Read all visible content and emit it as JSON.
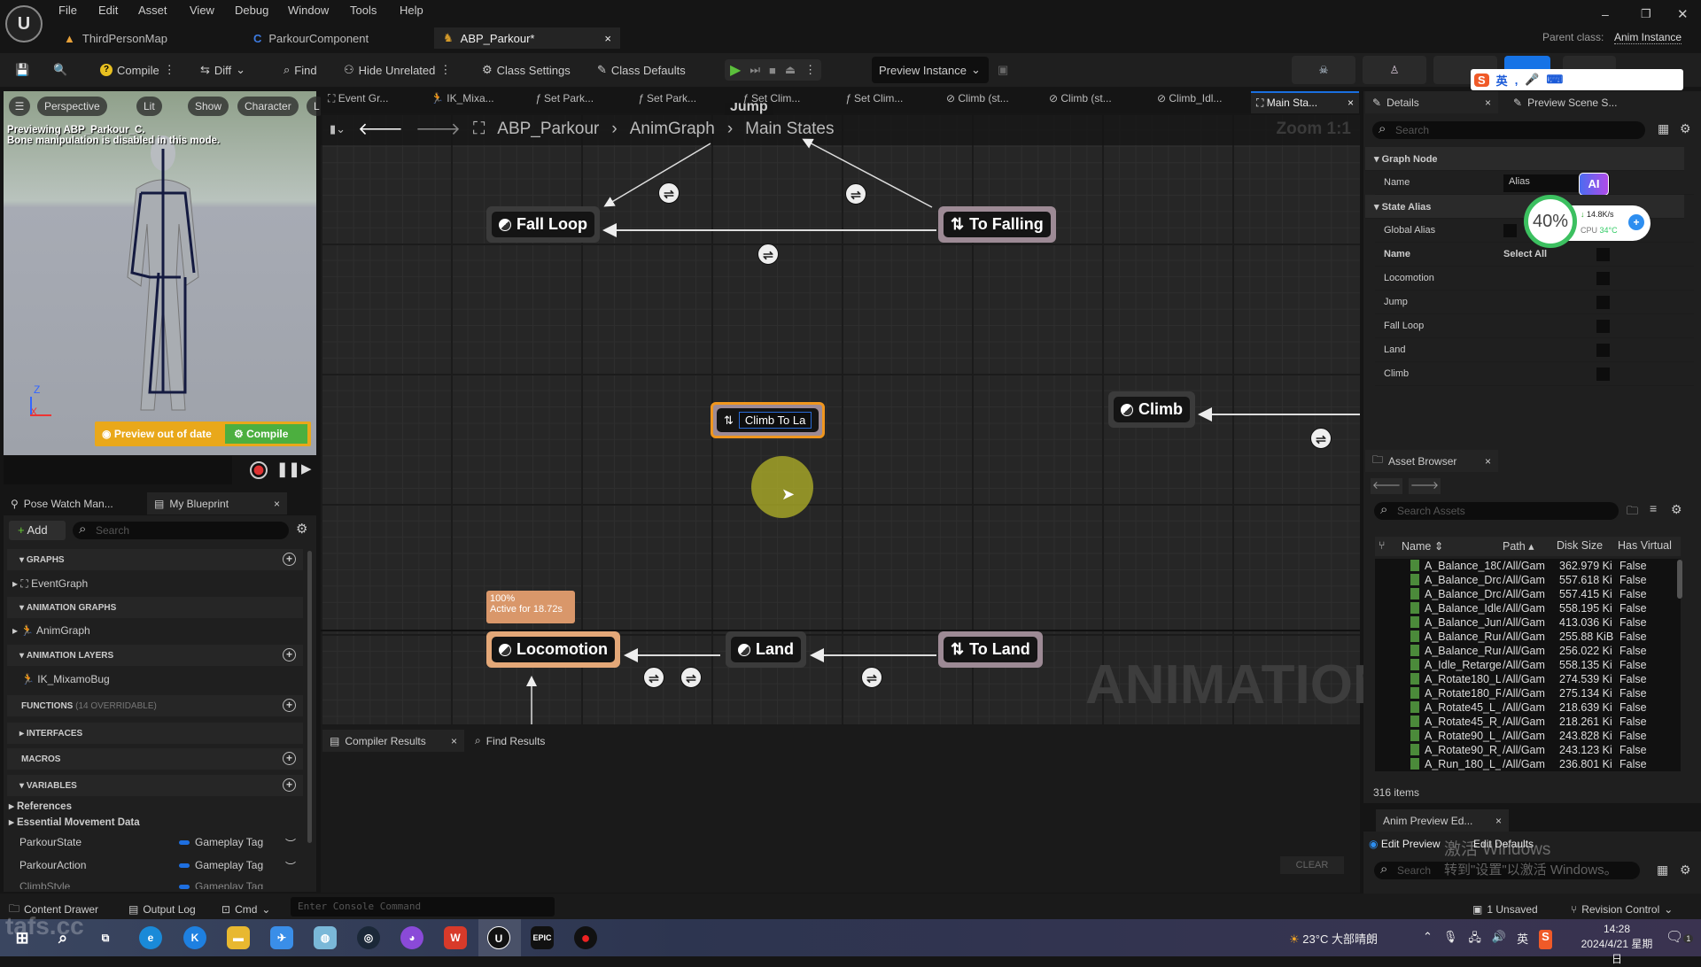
{
  "menu": [
    "File",
    "Edit",
    "Asset",
    "View",
    "Debug",
    "Window",
    "Tools",
    "Help"
  ],
  "doc_tabs": [
    {
      "label": "ThirdPersonMap"
    },
    {
      "label": "ParkourComponent"
    },
    {
      "label": "ABP_Parkour*",
      "active": true
    }
  ],
  "parent_class": {
    "label": "Parent class:",
    "value": "Anim Instance"
  },
  "toolbar": {
    "compile": "Compile",
    "diff": "Diff",
    "find": "Find",
    "hide_unrelated": "Hide Unrelated",
    "class_settings": "Class Settings",
    "class_defaults": "Class Defaults",
    "preview_instance": "Preview Instance"
  },
  "viewport": {
    "chips": [
      "Perspective",
      "Lit",
      "Show",
      "Character",
      "L"
    ],
    "info_line1": "Previewing ABP_Parkour_C.",
    "info_line2": "Bone manipulation is disabled in this mode.",
    "preview_out_of_date": "Preview out of date",
    "compile": "Compile",
    "axis_z": "Z",
    "axis_x": "X"
  },
  "left_tabs": {
    "pose_watch": "Pose Watch Man...",
    "my_blueprint": "My Blueprint"
  },
  "my_blueprint": {
    "add": "Add",
    "search_placeholder": "Search",
    "sections": {
      "graphs": "GRAPHS",
      "anim_graphs": "ANIMATION GRAPHS",
      "anim_layers": "ANIMATION LAYERS",
      "functions": "FUNCTIONS",
      "functions_note": "(14 OVERRIDABLE)",
      "interfaces": "INTERFACES",
      "macros": "MACROS",
      "variables": "VARIABLES"
    },
    "event_graph": "EventGraph",
    "anim_graph": "AnimGraph",
    "layer": "IK_MixamoBug",
    "references": "References",
    "essential": "Essential Movement Data",
    "variables": [
      {
        "name": "ParkourState",
        "type": "Gameplay Tag"
      },
      {
        "name": "ParkourAction",
        "type": "Gameplay Tag"
      },
      {
        "name": "ClimbStyle",
        "type": "Gameplay Tag"
      }
    ]
  },
  "graph_tabs": [
    "Event Gr...",
    "IK_Mixa...",
    "Set Park...",
    "Set Park...",
    "Set Clim...",
    "Set Clim...",
    "Climb (st...",
    "Climb (st...",
    "Climb_Idl...",
    "Main Sta..."
  ],
  "breadcrumb": [
    "ABP_Parkour",
    "AnimGraph",
    "Main States"
  ],
  "zoom": "Zoom 1:1",
  "nodes": {
    "jump": "Jump",
    "fall_loop": "Fall Loop",
    "to_falling": "To Falling",
    "climb_to_la": "Climb To La",
    "climb": "Climb",
    "locomotion": "Locomotion",
    "land": "Land",
    "to_land": "To Land"
  },
  "tooltip": {
    "weight": "100%",
    "active": "Active for 18.72s"
  },
  "watermark": "ANIMATION",
  "bottom_tabs": {
    "compiler_results": "Compiler Results",
    "find_results": "Find Results",
    "clear": "CLEAR"
  },
  "details": {
    "tab": "Details",
    "preview_tab": "Preview Scene S...",
    "search_placeholder": "Search",
    "graph_node": "Graph Node",
    "name_label": "Name",
    "name_value": "Alias",
    "state_alias": "State Alias",
    "global_alias": "Global Alias",
    "name_header": "Name",
    "select_all": "Select All",
    "states": [
      "Locomotion",
      "Jump",
      "Fall Loop",
      "Land",
      "Climb"
    ]
  },
  "overlay_widget": {
    "percent": "40%",
    "net": "14.8K/s",
    "cpu_label": "CPU",
    "cpu_temp": "34°C",
    "ai": "AI"
  },
  "asset_browser": {
    "tab": "Asset Browser",
    "search_placeholder": "Search Assets",
    "columns": [
      "Name",
      "Path",
      "Disk Size",
      "Has Virtual"
    ],
    "rows": [
      [
        "A_Balance_180_",
        "/All/Gam",
        "362.979 Ki",
        "False"
      ],
      [
        "A_Balance_Dro",
        "/All/Gam",
        "557.618 Ki",
        "False"
      ],
      [
        "A_Balance_Dro",
        "/All/Gam",
        "557.415 Ki",
        "False"
      ],
      [
        "A_Balance_Idle_",
        "/All/Gam",
        "558.195 Ki",
        "False"
      ],
      [
        "A_Balance_Jum",
        "/All/Gam",
        "413.036 Ki",
        "False"
      ],
      [
        "A_Balance_Run_",
        "/All/Gam",
        "255.88 KiB",
        "False"
      ],
      [
        "A_Balance_Run_",
        "/All/Gam",
        "256.022 Ki",
        "False"
      ],
      [
        "A_Idle_Retarget",
        "/All/Gam",
        "558.135 Ki",
        "False"
      ],
      [
        "A_Rotate180_L_",
        "/All/Gam",
        "274.539 Ki",
        "False"
      ],
      [
        "A_Rotate180_R_",
        "/All/Gam",
        "275.134 Ki",
        "False"
      ],
      [
        "A_Rotate45_L_F",
        "/All/Gam",
        "218.639 Ki",
        "False"
      ],
      [
        "A_Rotate45_R_F",
        "/All/Gam",
        "218.261 Ki",
        "False"
      ],
      [
        "A_Rotate90_L_F",
        "/All/Gam",
        "243.828 Ki",
        "False"
      ],
      [
        "A_Rotate90_R_F",
        "/All/Gam",
        "243.123 Ki",
        "False"
      ],
      [
        "A_Run_180_L_R",
        "/All/Gam",
        "236.801 Ki",
        "False"
      ]
    ],
    "count": "316 items"
  },
  "anim_preview": {
    "tab": "Anim Preview Ed...",
    "edit_preview": "Edit Preview",
    "edit_defaults": "Edit Defaults",
    "search_placeholder": "Search"
  },
  "activation": {
    "line1": "激活 Windows",
    "line2": "转到\"设置\"以激活 Windows。"
  },
  "statusbar": {
    "content_drawer": "Content Drawer",
    "output_log": "Output Log",
    "cmd": "Cmd",
    "console_placeholder": "Enter Console Command",
    "unsaved": "1 Unsaved",
    "revision_control": "Revision Control"
  },
  "taskbar": {
    "weather": "23°C 大部晴朗",
    "ime": "英",
    "time": "14:28",
    "date": "2024/4/21 星期日",
    "notifications": "1",
    "watermark": "tafs.cc"
  }
}
